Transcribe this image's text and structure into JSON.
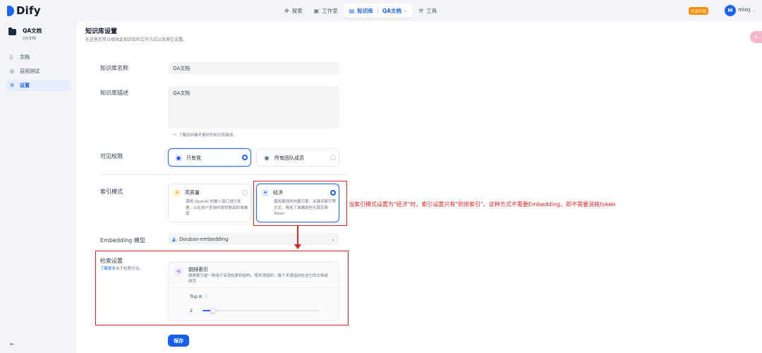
{
  "app": {
    "logo_text": "Dify"
  },
  "topnav": {
    "explore": "探索",
    "studio": "工作室",
    "knowledge": "知识库",
    "current_dataset": "QA文档",
    "tools": "工具"
  },
  "env_badge": "开发环境",
  "user": {
    "avatar_letter": "M",
    "name": "mlxq"
  },
  "sidebar": {
    "dataset_name": "QA文档",
    "dataset_sub": "QA文档",
    "items": [
      {
        "label": "文档",
        "icon": "document-icon",
        "active": false
      },
      {
        "label": "召回测试",
        "icon": "target-icon",
        "active": false
      },
      {
        "label": "设置",
        "icon": "settings-icon",
        "active": true
      }
    ]
  },
  "page": {
    "title": "知识库设置",
    "description": "在这里您可以修改此知识库的工作方式以及其它设置。"
  },
  "form": {
    "name_label": "知识库名称",
    "name_value": "QA文档",
    "desc_label": "知识库描述",
    "desc_value": "QA文档",
    "desc_hint": "了解如何编写更好的知识库描述。",
    "permission_label": "可见权限",
    "permission_options": [
      {
        "label": "只有我",
        "selected": true
      },
      {
        "label": "所有团队成员",
        "selected": false
      }
    ],
    "index_label": "索引模式",
    "index_options": [
      {
        "label": "高质量",
        "desc": "调用 OpenAI 的嵌入接口进行处理，以在用户查询时提供更高的准确度",
        "selected": false
      },
      {
        "label": "经济",
        "desc": "使用离线的向量引擎、关键词索引等方式，降低了准确度但无需花费 Token",
        "selected": true
      }
    ],
    "embedding_label": "Embedding 模型",
    "embedding_value": "Doubao-embedding",
    "retrieval_label": "检索设置",
    "retrieval_learn_more": "了解更多",
    "retrieval_learn_more_suffix": "关于检索方法。",
    "retrieval_method_title": "倒排索引",
    "retrieval_method_desc": "倒排索引是一种用于高效检索的结构。按术语组织，每个术语指向包含它的文档或网页",
    "topk_label": "Top K",
    "topk_value": "2",
    "topk_fraction": 0.09,
    "save_label": "保存"
  },
  "annotation": {
    "text": "当索引模式设置为\"经济\"时，索引设置只有\"倒排索引\"。这种方式不需要Embedding，即不需要消耗token",
    "color": "#e02424"
  },
  "colors": {
    "primary": "#1c64f2",
    "env_badge": "#f79009"
  }
}
